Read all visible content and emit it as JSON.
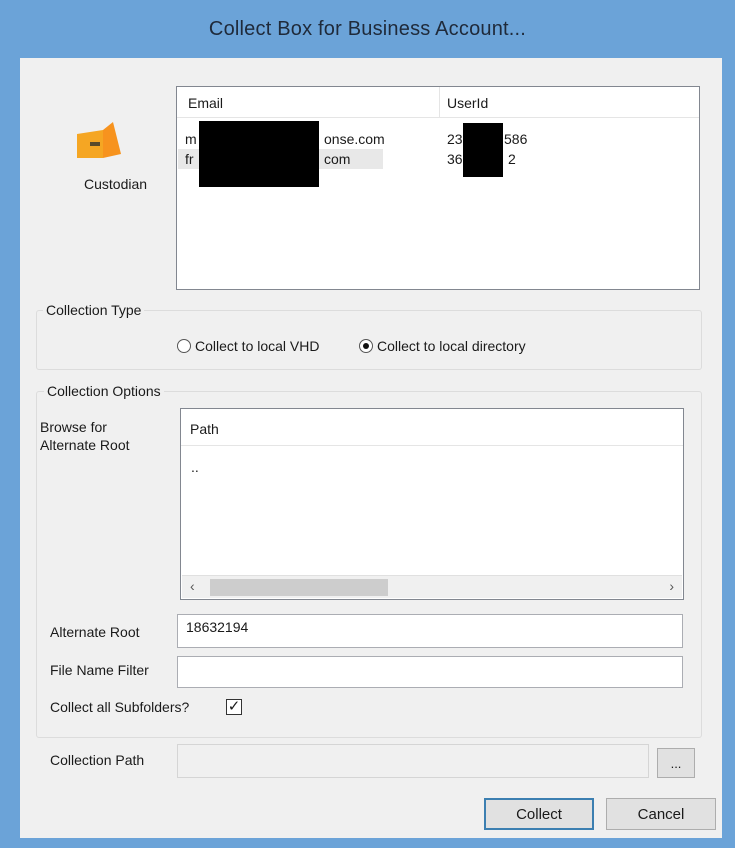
{
  "window": {
    "title": "Collect Box for Business Account..."
  },
  "custodian": {
    "label": "Custodian",
    "columns": [
      "Email",
      "UserId"
    ],
    "rows": [
      {
        "email_start": "m",
        "email_end": "onse.com",
        "userid_start": "23",
        "userid_end": "586"
      },
      {
        "email_start": "fr",
        "email_end": "com",
        "userid_start": "36",
        "userid_end": "2"
      }
    ]
  },
  "collection_type": {
    "label": "Collection Type",
    "options": [
      {
        "label": "Collect to local VHD",
        "selected": false
      },
      {
        "label": "Collect to local directory",
        "selected": true
      }
    ]
  },
  "collection_options": {
    "label": "Collection Options",
    "browse_label": "Browse for Alternate Root",
    "path_header": "Path",
    "path_rows": [
      ".."
    ],
    "alternate_root_label": "Alternate Root",
    "alternate_root_value": "18632194",
    "file_name_filter_label": "File Name Filter",
    "file_name_filter_value": "",
    "subfolders_label": "Collect all Subfolders?",
    "subfolders_checked": true,
    "check_mark": "✓"
  },
  "collection_path": {
    "label": "Collection Path",
    "value": "",
    "browse_button": "..."
  },
  "buttons": {
    "collect": "Collect",
    "cancel": "Cancel"
  },
  "scroll": {
    "left_arrow": "‹",
    "right_arrow": "›"
  },
  "colors": {
    "title_bar": "#6ba3d8",
    "client": "#f0f0f0",
    "icon_orange": "#f5a623"
  }
}
